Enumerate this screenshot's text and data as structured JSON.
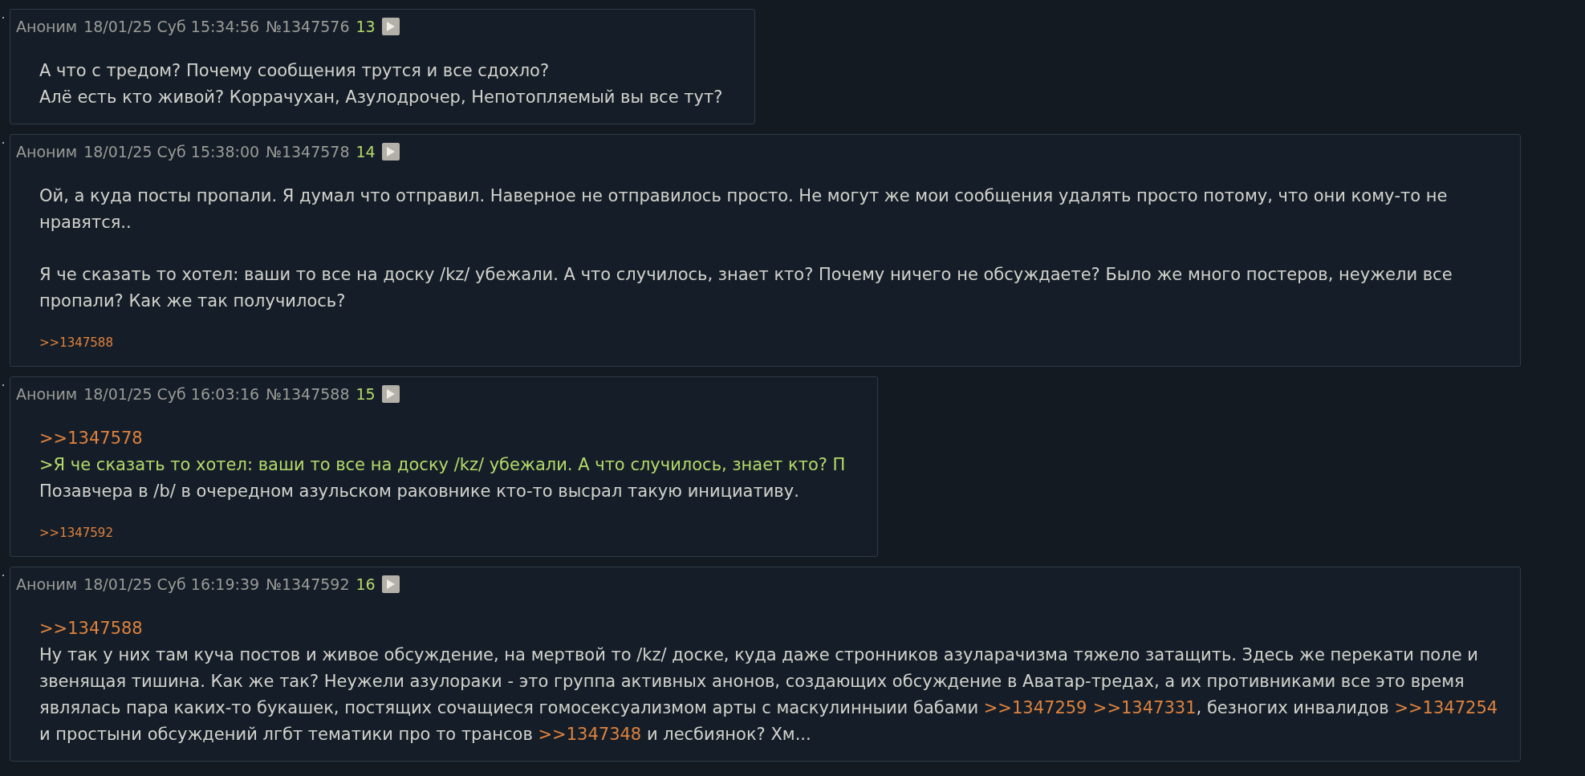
{
  "posts": [
    {
      "name": "Аноним",
      "date": "18/01/25 Суб 15:34:56",
      "number": "№1347576",
      "index": "13",
      "paragraphs": [
        [
          [
            {
              "kind": "text",
              "text": "А что с тредом? Почему сообщения трутся и все сдохло?"
            }
          ],
          [
            {
              "kind": "text",
              "text": "Алё есть кто живой? Коррачухан, Азулодрочер, Непотопляемый вы все тут?"
            }
          ]
        ]
      ]
    },
    {
      "name": "Аноним",
      "date": "18/01/25 Суб 15:38:00",
      "number": "№1347578",
      "index": "14",
      "paragraphs": [
        [
          [
            {
              "kind": "text",
              "text": "Ой, а куда посты пропали. Я думал что отправил. Наверное не отправилось просто. Не могут же мои сообщения удалять просто потому, что они кому-то не"
            }
          ],
          [
            {
              "kind": "text",
              "text": "нравятся.."
            }
          ]
        ],
        [
          [
            {
              "kind": "text",
              "text": "Я че сказать то хотел: ваши то все на доску /kz/ убежали. А что случилось, знает кто? Почему ничего не обсуждаете? Было же много постеров, неужели все"
            }
          ],
          [
            {
              "kind": "text",
              "text": "пропали? Как же так получилось?"
            }
          ]
        ]
      ],
      "replies": [
        ">>1347588"
      ]
    },
    {
      "name": "Аноним",
      "date": "18/01/25 Суб 16:03:16",
      "number": "№1347588",
      "index": "15",
      "paragraphs": [
        [
          [
            {
              "kind": "link",
              "text": ">>1347578"
            }
          ],
          [
            {
              "kind": "quote",
              "text": ">Я че сказать то хотел: ваши то все на доску /kz/ убежали. А что случилось, знает кто? П"
            }
          ],
          [
            {
              "kind": "text",
              "text": "Позавчера в /b/ в очередном азульском раковнике кто-то высрал такую инициативу."
            }
          ]
        ]
      ],
      "replies": [
        ">>1347592"
      ]
    },
    {
      "name": "Аноним",
      "date": "18/01/25 Суб 16:19:39",
      "number": "№1347592",
      "index": "16",
      "paragraphs": [
        [
          [
            {
              "kind": "link",
              "text": ">>1347588"
            }
          ],
          [
            {
              "kind": "text",
              "text": "Ну так у них там куча постов и живое обсуждение, на мертвой то /kz/ доске, куда даже стронников азуларачизма тяжело затащить. Здесь же перекати поле и"
            }
          ],
          [
            {
              "kind": "text",
              "text": "звенящая тишина. Как же так? Неужели азулораки - это группа активных анонов, создающих обсуждение в Аватар-тредах, а их противниками все это время"
            }
          ],
          [
            {
              "kind": "text",
              "text": "являлась пара каких-то букашек, постящих сочащиеся гомосексуализмом арты с маскулинныии бабами "
            },
            {
              "kind": "link",
              "text": ">>1347259"
            },
            {
              "kind": "link",
              "text": ">>1347331"
            },
            {
              "kind": "text",
              "text": ", безногих инвалидов "
            },
            {
              "kind": "link",
              "text": ">>1347254"
            }
          ],
          [
            {
              "kind": "text",
              "text": "и простыни обсуждений лгбт тематики про то трансов "
            },
            {
              "kind": "link",
              "text": ">>1347348"
            },
            {
              "kind": "text",
              "text": " и лесбиянок? Хм..."
            }
          ]
        ]
      ]
    }
  ]
}
